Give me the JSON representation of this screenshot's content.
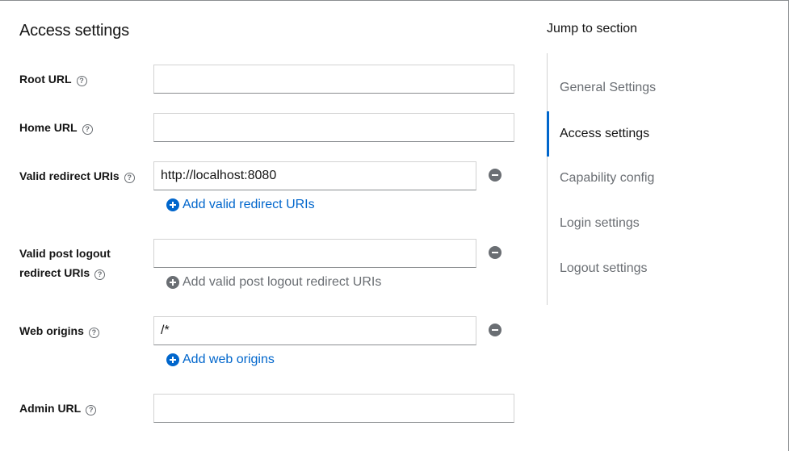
{
  "section_title": "Access settings",
  "jump": {
    "title": "Jump to section",
    "items": [
      {
        "label": "General Settings",
        "active": false
      },
      {
        "label": "Access settings",
        "active": true
      },
      {
        "label": "Capability config",
        "active": false
      },
      {
        "label": "Login settings",
        "active": false
      },
      {
        "label": "Logout settings",
        "active": false
      }
    ]
  },
  "fields": {
    "root_url": {
      "label": "Root URL",
      "value": ""
    },
    "home_url": {
      "label": "Home URL",
      "value": ""
    },
    "valid_redirect": {
      "label": "Valid redirect URIs",
      "value": "http://localhost:8080",
      "add_label": "Add valid redirect URIs"
    },
    "post_logout": {
      "label_line1": "Valid post logout",
      "label_line2": "redirect URIs",
      "value": "",
      "add_label": "Add valid post logout redirect URIs"
    },
    "web_origins": {
      "label": "Web origins",
      "value": "/*",
      "add_label": "Add web origins"
    },
    "admin_url": {
      "label": "Admin URL",
      "value": ""
    }
  },
  "help_icon_glyph": "?",
  "colors": {
    "link": "#0066cc",
    "disabled": "#6a6e73",
    "active_indicator": "#0066cc"
  }
}
